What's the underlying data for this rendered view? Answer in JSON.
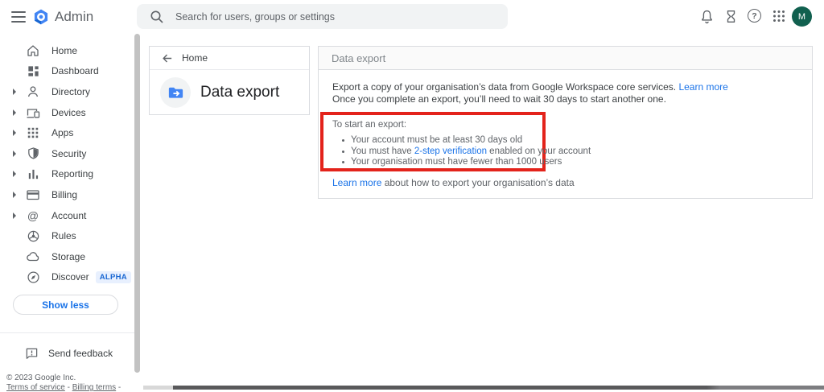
{
  "header": {
    "app_name": "Admin",
    "search_placeholder": "Search for users, groups or settings",
    "avatar_initial": "M",
    "help_glyph": "?",
    "at_glyph": "@"
  },
  "sidebar": {
    "items": [
      {
        "label": "Home"
      },
      {
        "label": "Dashboard"
      },
      {
        "label": "Directory"
      },
      {
        "label": "Devices"
      },
      {
        "label": "Apps"
      },
      {
        "label": "Security"
      },
      {
        "label": "Reporting"
      },
      {
        "label": "Billing"
      },
      {
        "label": "Account"
      },
      {
        "label": "Rules"
      },
      {
        "label": "Storage"
      },
      {
        "label": "Discover",
        "badge": "ALPHA"
      }
    ],
    "show_less": "Show less",
    "send_feedback": "Send feedback",
    "copyright": "© 2023 Google Inc.",
    "terms_link": "Terms of service",
    "separator": " - ",
    "billing_terms_link": "Billing terms",
    "trailing_separator": " -"
  },
  "breadcrumb_card": {
    "back_label": "Home",
    "title": "Data export"
  },
  "panel": {
    "header_title": "Data export",
    "intro_line1": "Export a copy of your organisation’s data from Google Workspace core services. ",
    "intro_link": "Learn more",
    "intro_line2": "Once you complete an export, you’ll need to wait 30 days to start another one.",
    "requirements_title": "To start an export:",
    "req1": "Your account must be at least 30 days old",
    "req2_prefix": "You must have ",
    "req2_link": "2-step verification",
    "req2_suffix": " enabled on your account",
    "req3": "Your organisation must have fewer than 1000 users",
    "footer_link": "Learn more",
    "footer_text": " about how to export your organisation’s data"
  },
  "colors": {
    "accent_blue": "#1a73e8",
    "annotation_red": "#e3231b",
    "badge_bg": "#e8f0fe",
    "badge_text": "#1967d2",
    "avatar_bg": "#11604f",
    "search_bg": "#f1f3f4"
  }
}
